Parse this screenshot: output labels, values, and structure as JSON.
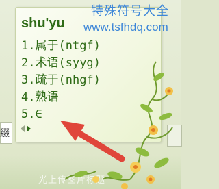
{
  "watermark": {
    "title": "特殊符号大全",
    "url": "www.tsfhdq.com"
  },
  "ime": {
    "pinyin_input": "shu'yu",
    "candidates": [
      {
        "index": "1.",
        "text": "属于(ntgf)"
      },
      {
        "index": "2.",
        "text": "术语(syyg)"
      },
      {
        "index": "3.",
        "text": "疏于(nhgf)"
      },
      {
        "index": "4.",
        "text": "熟语"
      },
      {
        "index": "5.",
        "text": "∈"
      }
    ]
  },
  "background": {
    "field_char": "綴",
    "faded_text": "光上传图片标题"
  },
  "colors": {
    "candidate_text": "#2f6b17",
    "watermark": "#3c86d8",
    "arrow": "#e0463a",
    "panel_bg": "#f3f8e2"
  },
  "icons": {
    "arrow": "red-arrow-pointing-up-left",
    "pager_prev": "triangle-left-icon",
    "pager_next": "triangle-right-icon",
    "decoration": "flower-vine-decoration"
  }
}
